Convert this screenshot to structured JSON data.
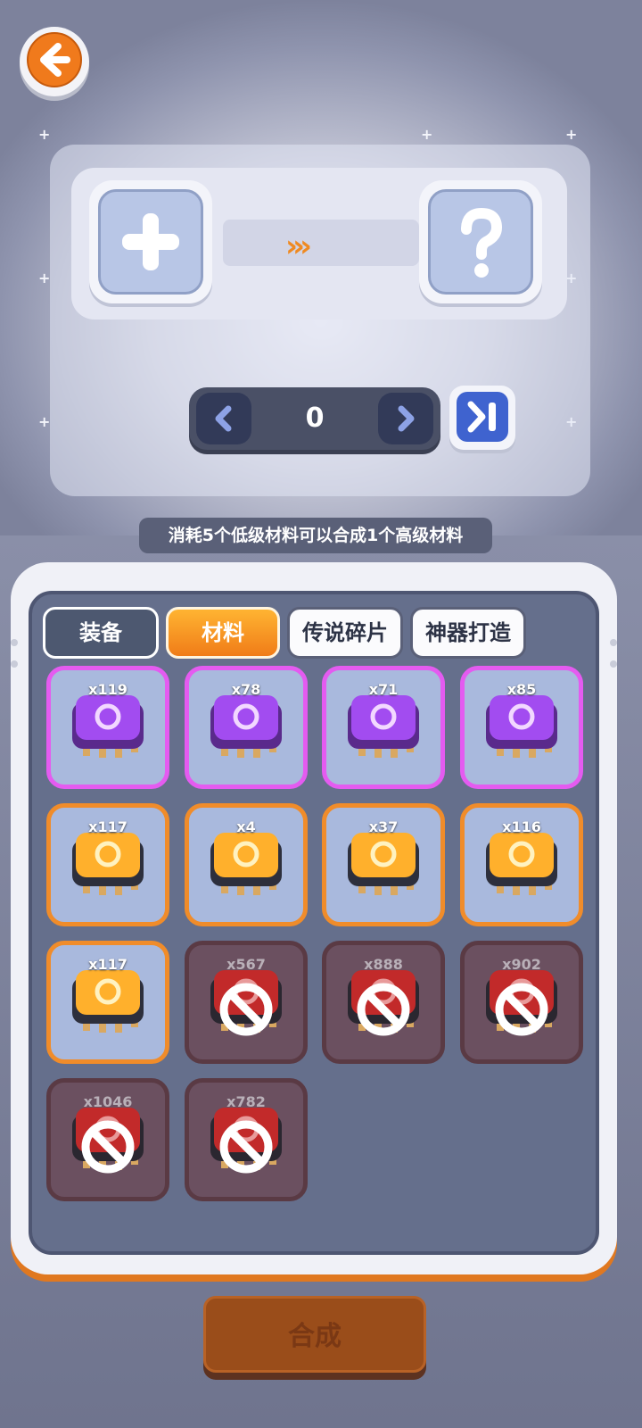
{
  "hint_text": "消耗5个低级材料可以合成1个高级材料",
  "counter": {
    "value": "0"
  },
  "tabs": [
    {
      "label": "装备",
      "state": "inactive"
    },
    {
      "label": "材料",
      "state": "active"
    },
    {
      "label": "传说碎片",
      "state": "inactive"
    },
    {
      "label": "神器打造",
      "state": "inactive"
    }
  ],
  "items": [
    {
      "count": "x119",
      "rarity": "purple",
      "locked": false,
      "icon": "gear-chip-icon"
    },
    {
      "count": "x78",
      "rarity": "purple",
      "locked": false,
      "icon": "target-chip-icon"
    },
    {
      "count": "x71",
      "rarity": "purple",
      "locked": false,
      "icon": "boot-chip-icon"
    },
    {
      "count": "x85",
      "rarity": "purple",
      "locked": false,
      "icon": "helmet-chip-icon"
    },
    {
      "count": "x117",
      "rarity": "orange",
      "locked": false,
      "icon": "armor-chip-icon"
    },
    {
      "count": "x4",
      "rarity": "orange",
      "locked": false,
      "icon": "gear-chip-icon"
    },
    {
      "count": "x37",
      "rarity": "orange",
      "locked": false,
      "icon": "target-chip-icon"
    },
    {
      "count": "x116",
      "rarity": "orange",
      "locked": false,
      "icon": "boot-chip-icon"
    },
    {
      "count": "x117",
      "rarity": "orange",
      "locked": false,
      "icon": "helmet-chip-icon"
    },
    {
      "count": "x567",
      "rarity": "red",
      "locked": true,
      "icon": "locked-chip-icon"
    },
    {
      "count": "x888",
      "rarity": "red",
      "locked": true,
      "icon": "locked-chip-icon"
    },
    {
      "count": "x902",
      "rarity": "red",
      "locked": true,
      "icon": "locked-chip-icon"
    },
    {
      "count": "x1046",
      "rarity": "red",
      "locked": true,
      "icon": "locked-chip-icon"
    },
    {
      "count": "x782",
      "rarity": "red",
      "locked": true,
      "icon": "locked-chip-icon"
    }
  ],
  "confirm_button": {
    "label": "合成"
  },
  "colors": {
    "accent_orange": "#f07c18",
    "purple_border": "#e45bf0",
    "orange_border": "#f08c2a",
    "panel_dark": "#656f8c"
  }
}
